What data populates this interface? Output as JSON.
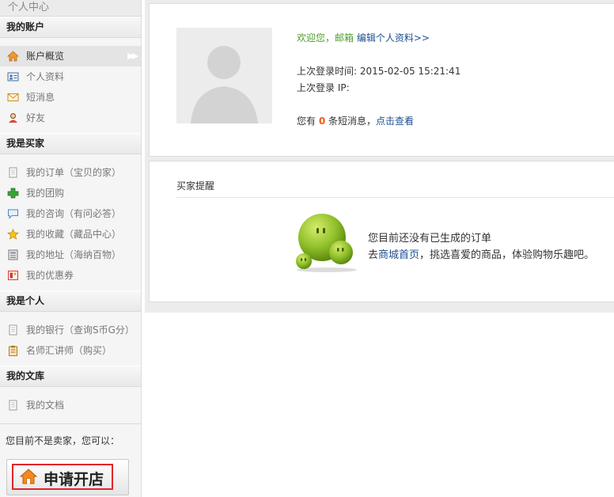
{
  "sidebar": {
    "title": "个人中心",
    "groups": [
      {
        "heading": "我的账户",
        "items": [
          {
            "label": "账户概览",
            "icon": "home-icon"
          },
          {
            "label": "个人资料",
            "icon": "id-card-icon"
          },
          {
            "label": "短消息",
            "icon": "envelope-icon"
          },
          {
            "label": "好友",
            "icon": "friend-icon"
          }
        ]
      },
      {
        "heading": "我是买家",
        "items": [
          {
            "label": "我的订单（宝贝的家）",
            "icon": "document-icon"
          },
          {
            "label": "我的团购",
            "icon": "puzzle-icon"
          },
          {
            "label": "我的咨询（有问必答）",
            "icon": "chat-bubble-icon"
          },
          {
            "label": "我的收藏（藏品中心）",
            "icon": "star-icon"
          },
          {
            "label": "我的地址（海纳百物）",
            "icon": "address-book-icon"
          },
          {
            "label": "我的优惠券",
            "icon": "coupon-icon"
          }
        ]
      },
      {
        "heading": "我是个人",
        "items": [
          {
            "label": "我的银行（查询S币G分）",
            "icon": "document-icon"
          },
          {
            "label": "名师汇讲师（购买）",
            "icon": "clipboard-icon"
          }
        ]
      },
      {
        "heading": "我的文库",
        "items": [
          {
            "label": "我的文档",
            "icon": "document-icon"
          }
        ]
      }
    ],
    "notice": "您目前不是卖家，您可以：",
    "apply_button": "申请开店"
  },
  "account": {
    "welcome": "欢迎您，邮箱",
    "edit_link": "编辑个人资料>>",
    "last_login_time_label": "上次登录时间:",
    "last_login_time": "2015-02-05 15:21:41",
    "last_login_ip_label": "上次登录 IP:",
    "msg_prefix": "您有",
    "msg_count": "0",
    "msg_suffix": "条短消息，",
    "msg_link": "点击查看"
  },
  "reminder": {
    "title": "买家提醒",
    "empty_line1": "您目前还没有已生成的订单",
    "empty_prefix": "去",
    "mall_link": "商城首页",
    "empty_suffix": "，挑选喜爱的商品，体验购物乐趣吧。"
  },
  "colors": {
    "accent_green": "#4f9e2b",
    "link_blue": "#1e4f91",
    "count_orange": "#f25a0f",
    "highlight_red": "#e0262b"
  }
}
